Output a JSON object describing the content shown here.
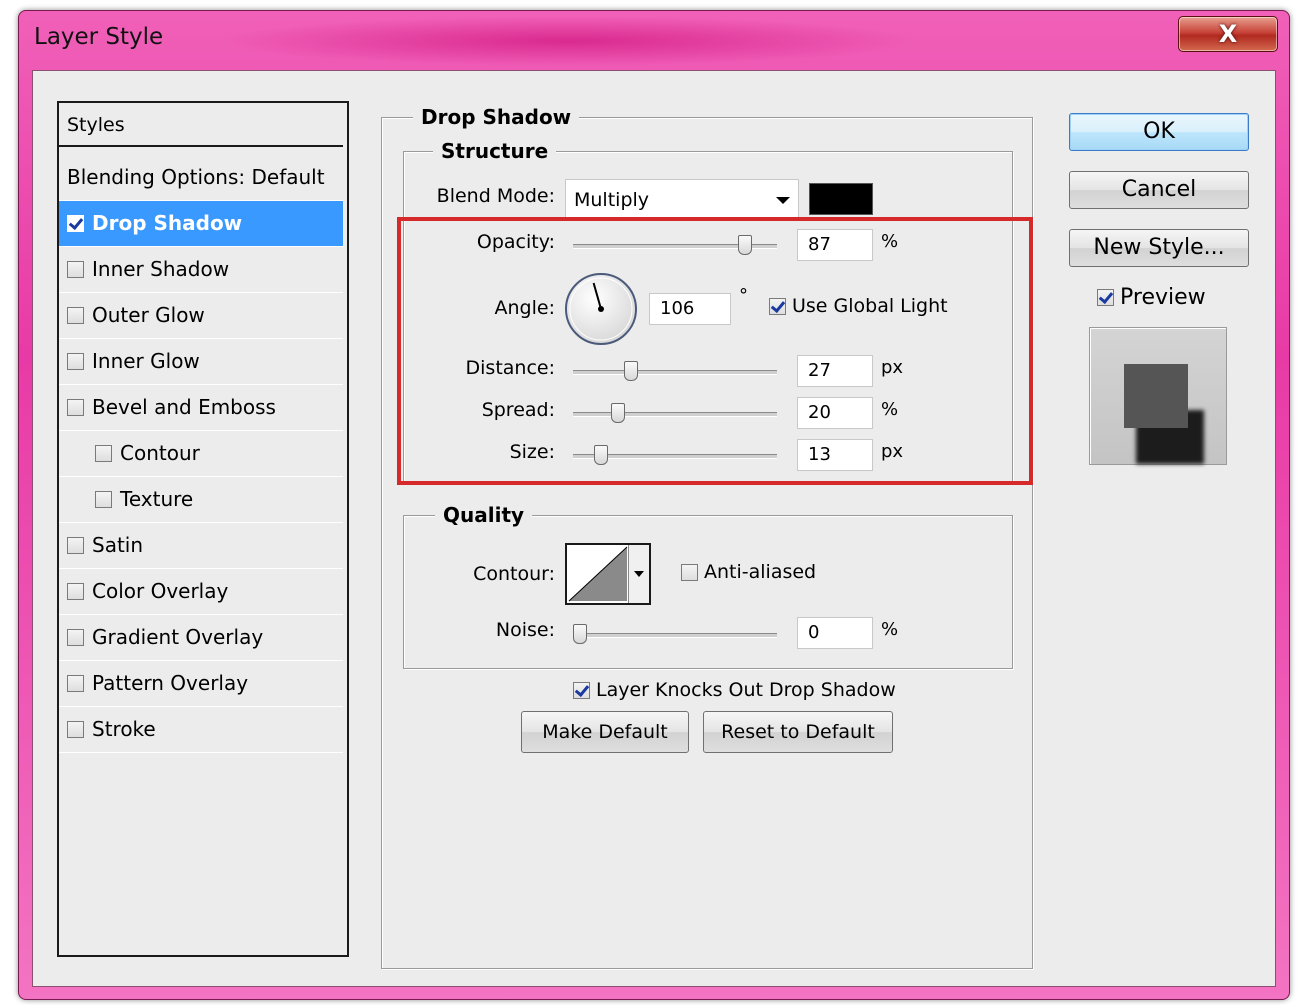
{
  "window": {
    "title": "Layer Style",
    "close_symbol": "X"
  },
  "styles_panel": {
    "header": "Styles",
    "items": [
      {
        "label": "Blending Options: Default",
        "checkbox": false
      },
      {
        "label": "Drop Shadow",
        "checkbox": true,
        "checked": true,
        "selected": true
      },
      {
        "label": "Inner Shadow",
        "checkbox": true,
        "checked": false
      },
      {
        "label": "Outer Glow",
        "checkbox": true,
        "checked": false
      },
      {
        "label": "Inner Glow",
        "checkbox": true,
        "checked": false
      },
      {
        "label": "Bevel and Emboss",
        "checkbox": true,
        "checked": false
      },
      {
        "label": "Contour",
        "checkbox": true,
        "checked": false,
        "indent": true
      },
      {
        "label": "Texture",
        "checkbox": true,
        "checked": false,
        "indent": true
      },
      {
        "label": "Satin",
        "checkbox": true,
        "checked": false
      },
      {
        "label": "Color Overlay",
        "checkbox": true,
        "checked": false
      },
      {
        "label": "Gradient Overlay",
        "checkbox": true,
        "checked": false
      },
      {
        "label": "Pattern Overlay",
        "checkbox": true,
        "checked": false
      },
      {
        "label": "Stroke",
        "checkbox": true,
        "checked": false
      }
    ]
  },
  "drop_shadow": {
    "title": "Drop Shadow",
    "structure": {
      "title": "Structure",
      "blend_mode_label": "Blend Mode:",
      "blend_mode_value": "Multiply",
      "shadow_color": "#000000",
      "opacity_label": "Opacity:",
      "opacity_value": "87",
      "opacity_unit": "%",
      "opacity_slider_fraction": 0.87,
      "angle_label": "Angle:",
      "angle_value": "106",
      "angle_unit": "°",
      "angle_degrees": 106,
      "use_global_light_label": "Use Global Light",
      "use_global_light_checked": true,
      "distance_label": "Distance:",
      "distance_value": "27",
      "distance_unit": "px",
      "distance_slider_fraction": 0.27,
      "spread_label": "Spread:",
      "spread_value": "20",
      "spread_unit": "%",
      "spread_slider_fraction": 0.2,
      "size_label": "Size:",
      "size_value": "13",
      "size_unit": "px",
      "size_slider_fraction": 0.11
    },
    "quality": {
      "title": "Quality",
      "contour_label": "Contour:",
      "anti_aliased_label": "Anti-aliased",
      "anti_aliased_checked": false,
      "noise_label": "Noise:",
      "noise_value": "0",
      "noise_unit": "%",
      "noise_slider_fraction": 0.0
    },
    "knockout_label": "Layer Knocks Out Drop Shadow",
    "knockout_checked": true,
    "make_default_label": "Make Default",
    "reset_default_label": "Reset to Default"
  },
  "buttons": {
    "ok": "OK",
    "cancel": "Cancel",
    "new_style": "New Style..."
  },
  "preview": {
    "label": "Preview",
    "checked": true
  },
  "colors": {
    "selection": "#3a99ff",
    "highlight": "#d62a2a",
    "titlebar": "#e83aa6"
  }
}
